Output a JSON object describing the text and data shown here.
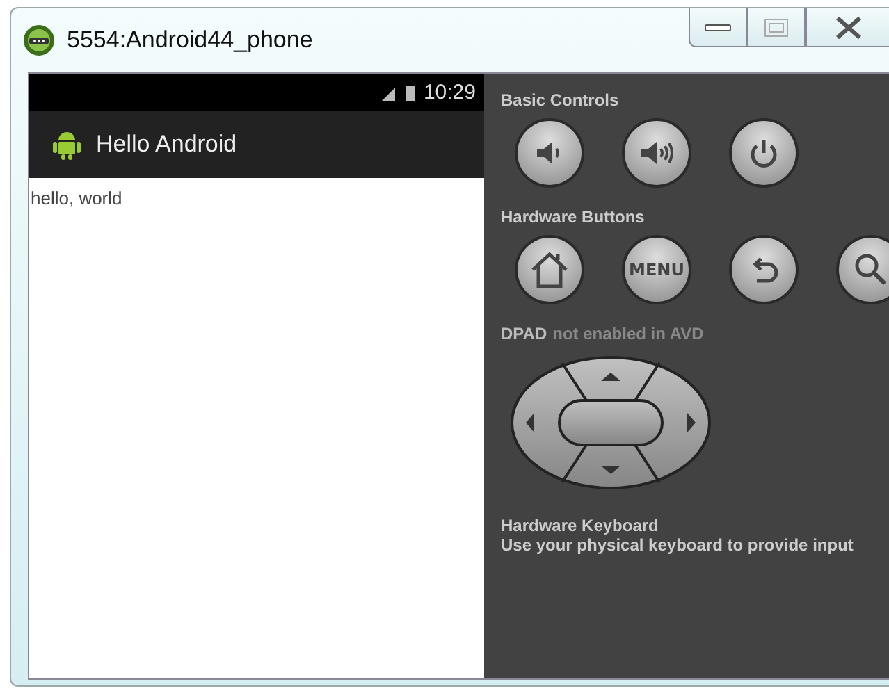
{
  "window": {
    "title": "5554:Android44_phone"
  },
  "phone": {
    "status_bar": {
      "time": "10:29"
    },
    "action_bar": {
      "title": "Hello Android"
    },
    "content": {
      "text": "hello, world"
    }
  },
  "controls": {
    "basic": {
      "title": "Basic Controls",
      "buttons": [
        {
          "kind": "volume-down"
        },
        {
          "kind": "volume-up"
        },
        {
          "kind": "power"
        }
      ]
    },
    "hardware": {
      "title": "Hardware Buttons",
      "buttons": [
        {
          "kind": "home"
        },
        {
          "kind": "menu",
          "label": "MENU"
        },
        {
          "kind": "back"
        },
        {
          "kind": "search"
        }
      ]
    },
    "dpad": {
      "title": "DPAD",
      "note": "not enabled in AVD",
      "disabled": true
    },
    "keyboard": {
      "title": "Hardware Keyboard",
      "note": "Use your physical keyboard to provide input"
    }
  }
}
